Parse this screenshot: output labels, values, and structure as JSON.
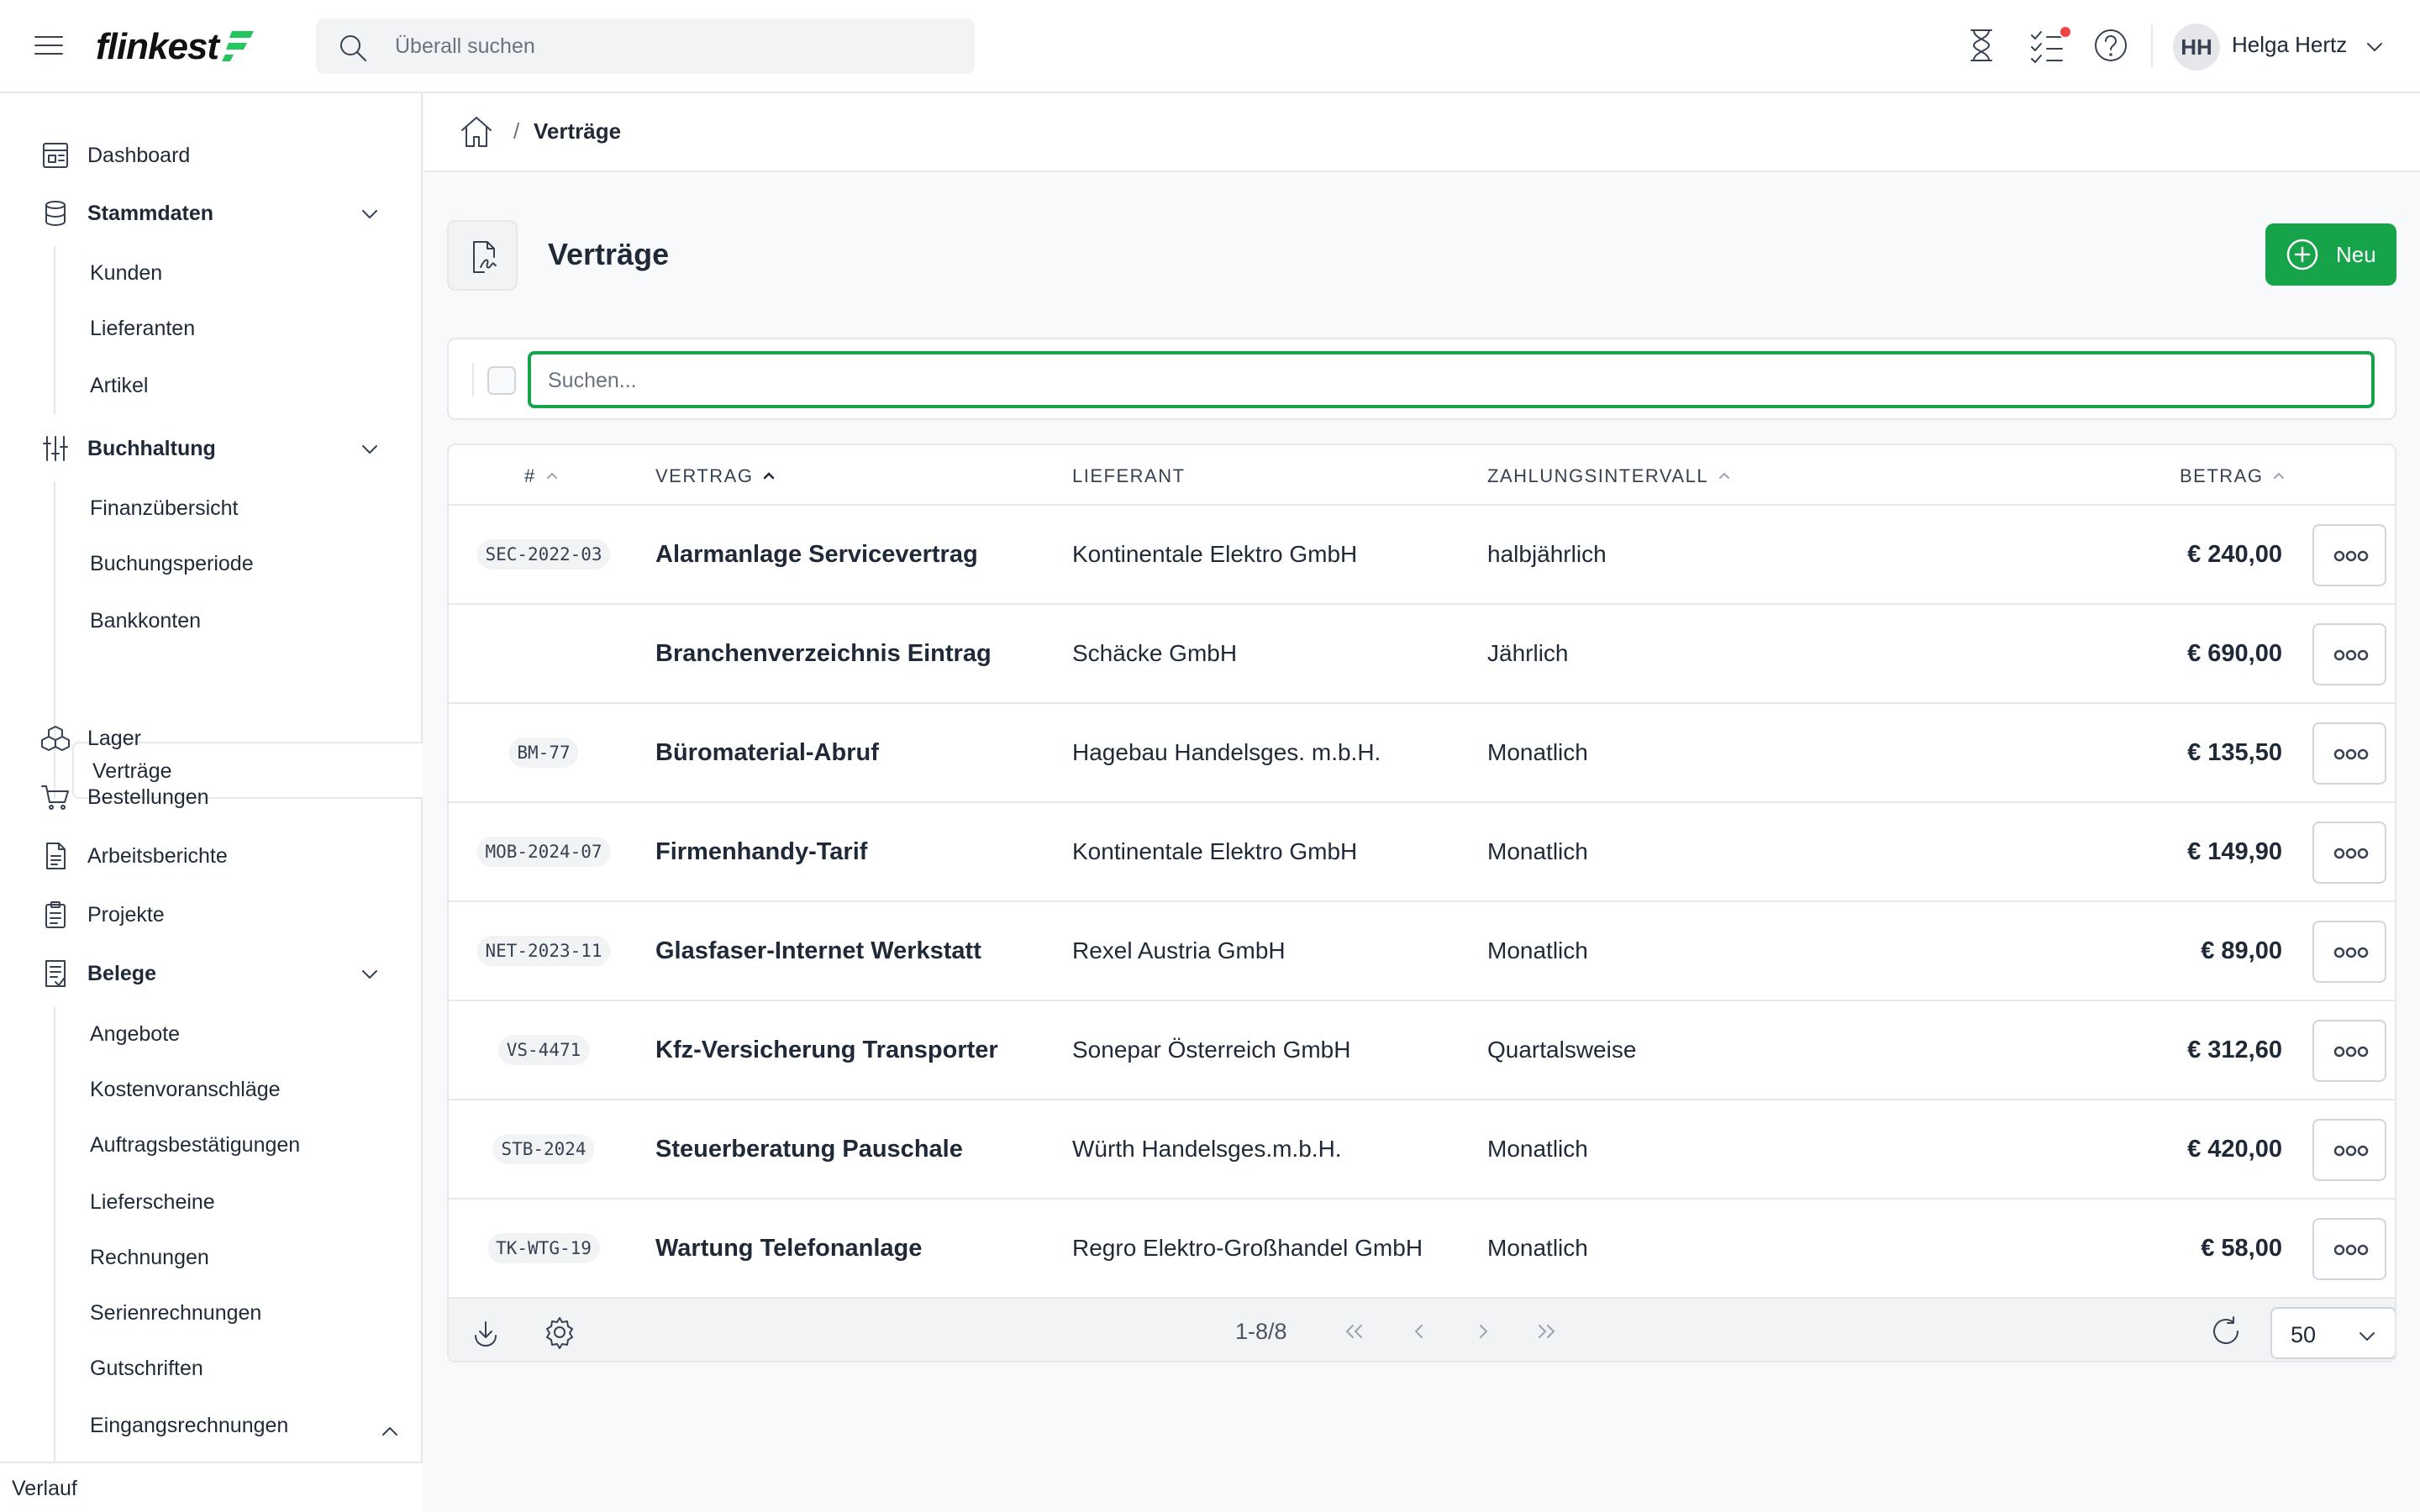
{
  "header": {
    "brand": "flinkest",
    "search_placeholder": "Überall suchen",
    "user_initials": "HH",
    "user_name": "Helga Hertz"
  },
  "sidebar": {
    "dashboard": "Dashboard",
    "stammdaten": "Stammdaten",
    "stammdaten_items": [
      "Kunden",
      "Lieferanten",
      "Artikel"
    ],
    "buchhaltung": "Buchhaltung",
    "buchhaltung_items": [
      "Finanzübersicht",
      "Buchungsperiode",
      "Bankkonten",
      "Verträge"
    ],
    "lager": "Lager",
    "bestellungen": "Bestellungen",
    "arbeitsberichte": "Arbeitsberichte",
    "projekte": "Projekte",
    "belege": "Belege",
    "belege_items": [
      "Angebote",
      "Kostenvoranschläge",
      "Auftragsbestätigungen",
      "Lieferscheine",
      "Rechnungen",
      "Serienrechnungen",
      "Gutschriften",
      "Eingangsrechnungen"
    ],
    "verlauf": "Verlauf"
  },
  "breadcrumb": {
    "sep": "/",
    "current": "Verträge"
  },
  "page": {
    "title": "Verträge",
    "new_label": "Neu",
    "filter_placeholder": "Suchen..."
  },
  "table": {
    "headers": {
      "num": "#",
      "vertrag": "VERTRAG",
      "lieferant": "LIEFERANT",
      "intervall": "ZAHLUNGSINTERVALL",
      "betrag": "BETRAG"
    },
    "rows": [
      {
        "id": "SEC-2022-03",
        "name": "Alarmanlage Servicevertrag",
        "supplier": "Kontinentale Elektro GmbH",
        "interval": "halbjährlich",
        "amount": "€ 240,00"
      },
      {
        "id": "",
        "name": "Branchenverzeichnis Eintrag",
        "supplier": "Schäcke GmbH",
        "interval": "Jährlich",
        "amount": "€ 690,00"
      },
      {
        "id": "BM-77",
        "name": "Büromaterial-Abruf",
        "supplier": "Hagebau Handelsges. m.b.H.",
        "interval": "Monatlich",
        "amount": "€ 135,50"
      },
      {
        "id": "MOB-2024-07",
        "name": "Firmenhandy-Tarif",
        "supplier": "Kontinentale Elektro GmbH",
        "interval": "Monatlich",
        "amount": "€ 149,90"
      },
      {
        "id": "NET-2023-11",
        "name": "Glasfaser-Internet Werkstatt",
        "supplier": "Rexel Austria GmbH",
        "interval": "Monatlich",
        "amount": "€ 89,00"
      },
      {
        "id": "VS-4471",
        "name": "Kfz-Versicherung Transporter",
        "supplier": "Sonepar Österreich GmbH",
        "interval": "Quartalsweise",
        "amount": "€ 312,60"
      },
      {
        "id": "STB-2024",
        "name": "Steuerberatung Pauschale",
        "supplier": "Würth Handelsges.m.b.H.",
        "interval": "Monatlich",
        "amount": "€ 420,00"
      },
      {
        "id": "TK-WTG-19",
        "name": "Wartung Telefonanlage",
        "supplier": "Regro Elektro-Großhandel GmbH",
        "interval": "Monatlich",
        "amount": "€ 58,00"
      }
    ],
    "pager": "1-8/8",
    "per_page": "50"
  },
  "colors": {
    "accent": "#16a34a",
    "notification": "#ef4444"
  }
}
